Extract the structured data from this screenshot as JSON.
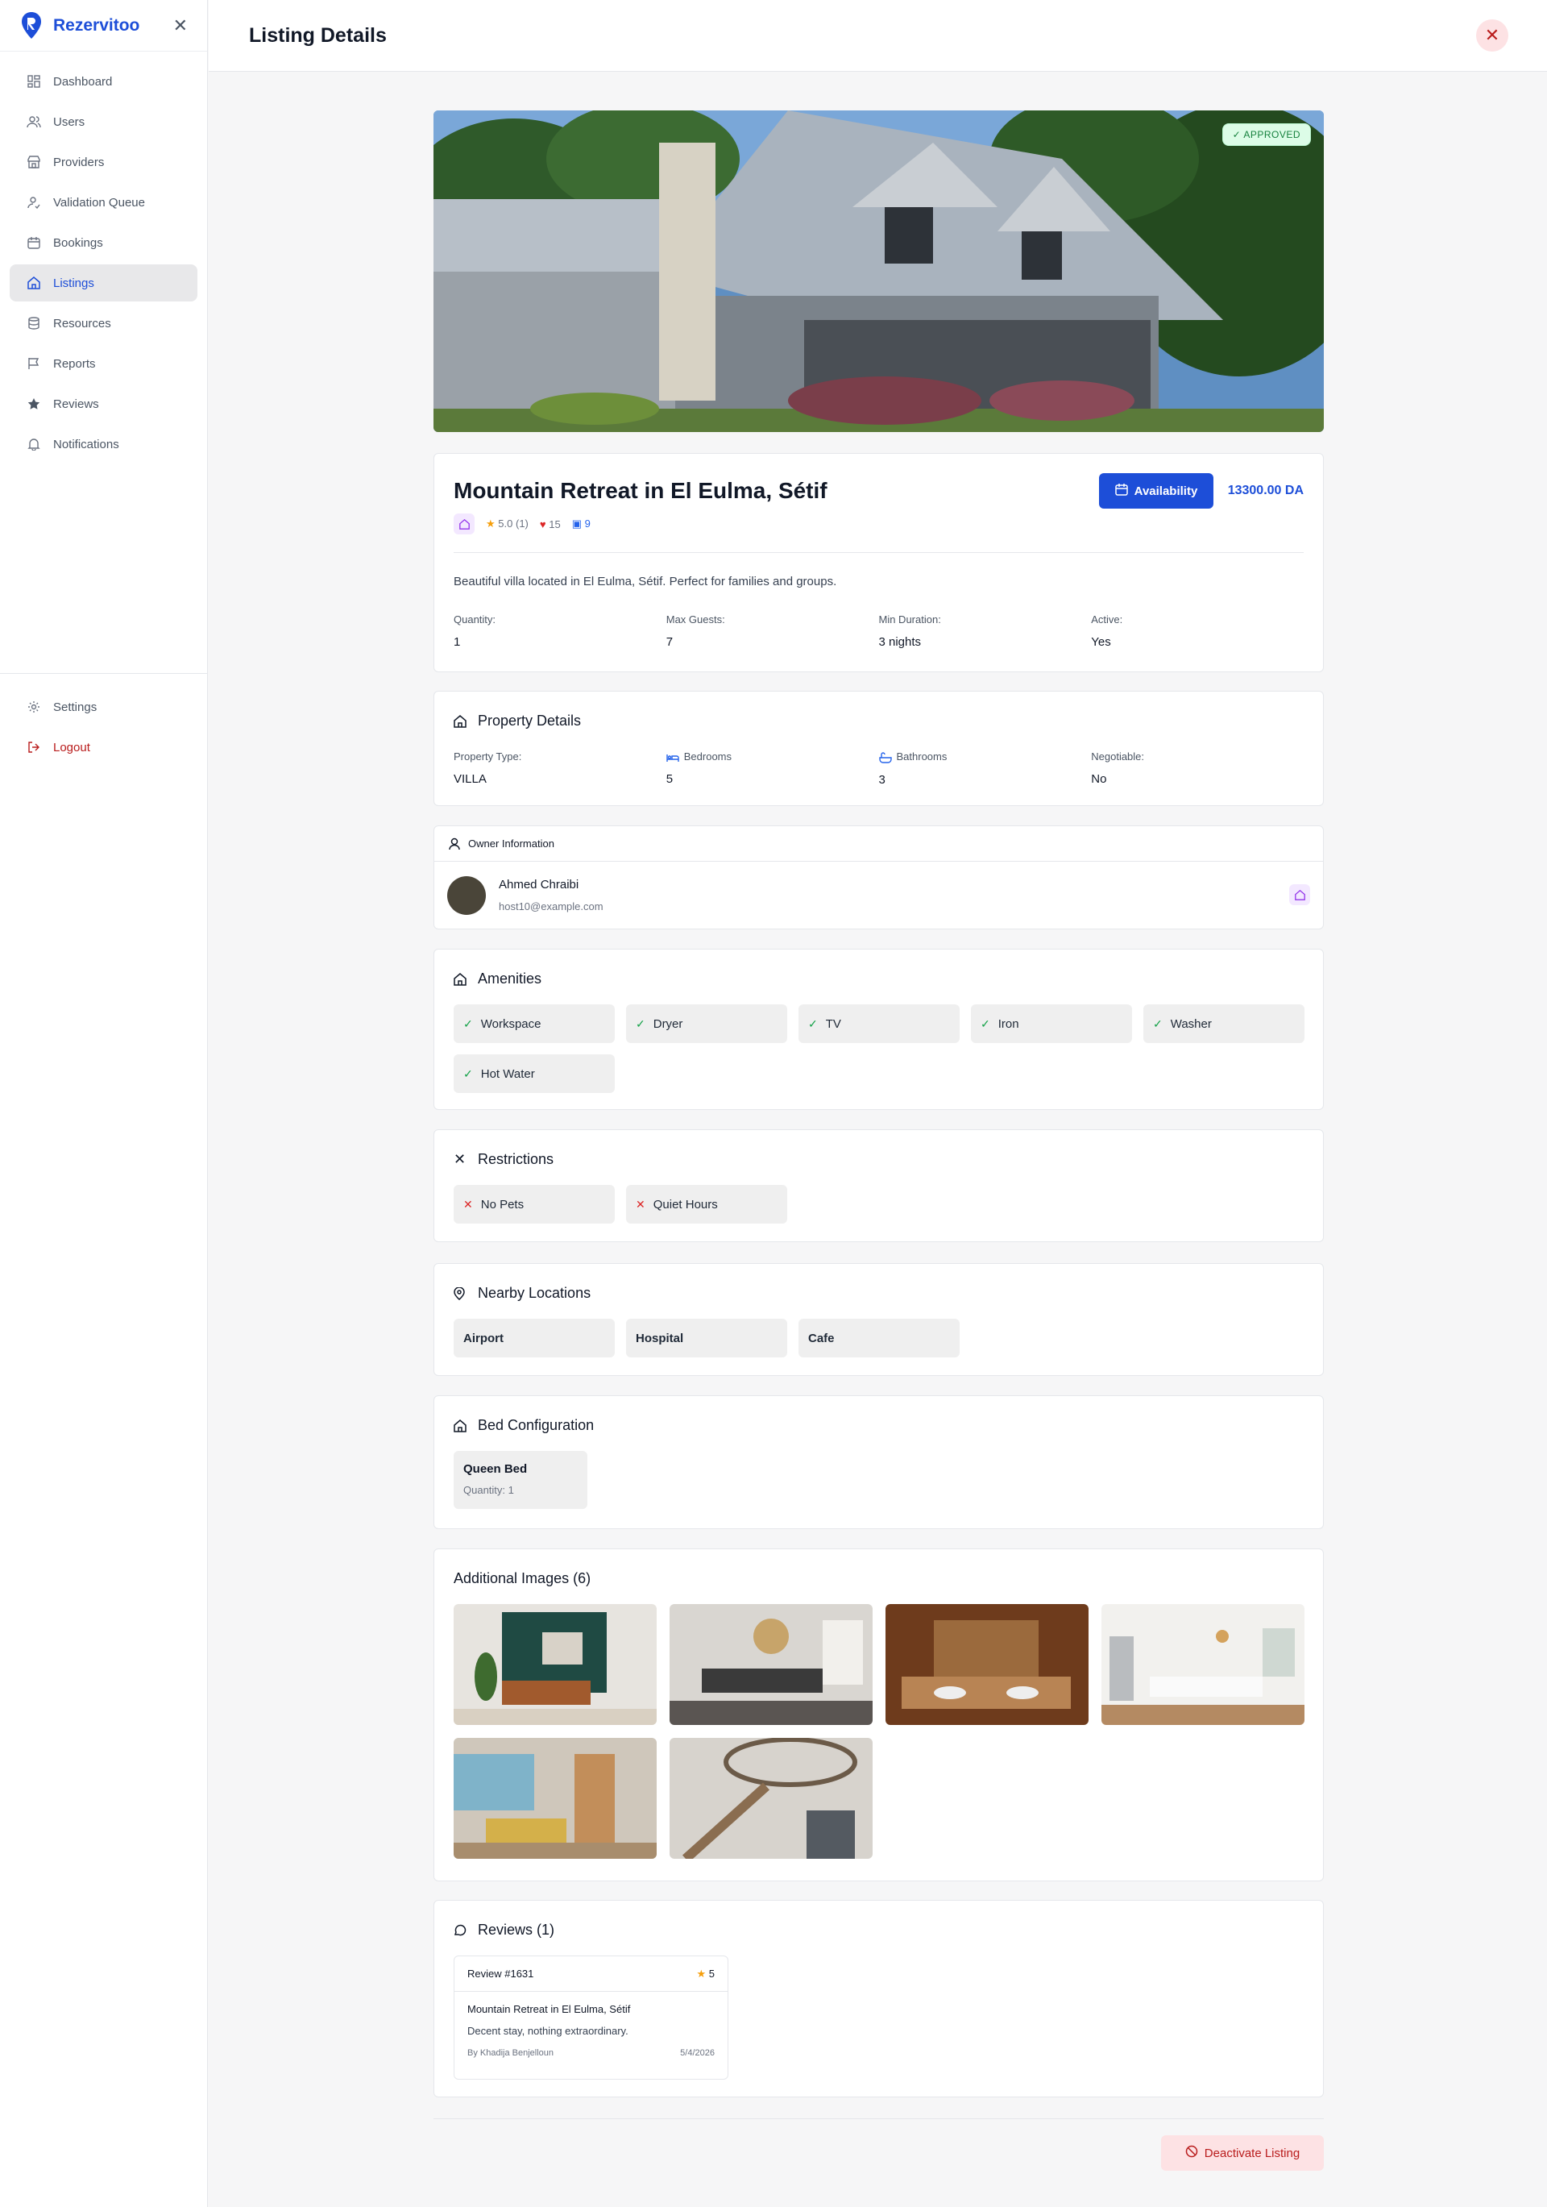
{
  "sidebar": {
    "brand": "Rezervitoo",
    "items": [
      {
        "label": "Dashboard",
        "icon": "dashboard-icon"
      },
      {
        "label": "Users",
        "icon": "users-icon"
      },
      {
        "label": "Providers",
        "icon": "store-icon"
      },
      {
        "label": "Validation Queue",
        "icon": "user-check-icon"
      },
      {
        "label": "Bookings",
        "icon": "calendar-icon"
      },
      {
        "label": "Listings",
        "icon": "home-icon",
        "active": true
      },
      {
        "label": "Resources",
        "icon": "database-icon"
      },
      {
        "label": "Reports",
        "icon": "flag-icon"
      },
      {
        "label": "Reviews",
        "icon": "star-icon"
      },
      {
        "label": "Notifications",
        "icon": "bell-icon"
      }
    ],
    "bottom": [
      {
        "label": "Settings",
        "icon": "gear-icon"
      },
      {
        "label": "Logout",
        "icon": "logout-icon"
      }
    ]
  },
  "header": {
    "title": "Listing Details"
  },
  "hero": {
    "status": "APPROVED"
  },
  "listing": {
    "title": "Mountain Retreat in El Eulma, Sétif",
    "rating": "5.0",
    "rating_count": "(1)",
    "likes": "15",
    "bookings": "9",
    "availability_label": "Availability",
    "price": "13300.00 DA",
    "description": "Beautiful villa located in El Eulma, Sétif. Perfect for families and groups.",
    "fields": [
      {
        "label": "Quantity:",
        "value": "1"
      },
      {
        "label": "Max Guests:",
        "value": "7"
      },
      {
        "label": "Min Duration:",
        "value": "3 nights"
      },
      {
        "label": "Active:",
        "value": "Yes"
      }
    ]
  },
  "property": {
    "title": "Property Details",
    "fields": [
      {
        "label": "Property Type:",
        "value": "VILLA"
      },
      {
        "label": "Bedrooms",
        "value": "5"
      },
      {
        "label": "Bathrooms",
        "value": "3"
      },
      {
        "label": "Negotiable:",
        "value": "No"
      }
    ]
  },
  "owner": {
    "title": "Owner Information",
    "name": "Ahmed Chraibi",
    "email": "host10@example.com"
  },
  "amenities": {
    "title": "Amenities",
    "items": [
      "Workspace",
      "Dryer",
      "TV",
      "Iron",
      "Washer",
      "Hot Water"
    ]
  },
  "restrictions": {
    "title": "Restrictions",
    "items": [
      "No Pets",
      "Quiet Hours"
    ]
  },
  "nearby": {
    "title": "Nearby Locations",
    "items": [
      "Airport",
      "Hospital",
      "Cafe"
    ]
  },
  "beds": {
    "title": "Bed Configuration",
    "name": "Queen Bed",
    "quantity": "Quantity: 1"
  },
  "images": {
    "title": "Additional Images (6)"
  },
  "reviews": {
    "title": "Reviews (1)",
    "id": "Review #1631",
    "stars": "5",
    "listing": "Mountain Retreat in El Eulma, Sétif",
    "text": "Decent stay, nothing extraordinary.",
    "author": "By Khadija Benjelloun",
    "date": "5/4/2026"
  },
  "actions": {
    "deactivate": "Deactivate Listing"
  },
  "colors": {
    "accent": "#1d4ed8",
    "danger": "#b91c1c",
    "success": "#16a34a"
  }
}
